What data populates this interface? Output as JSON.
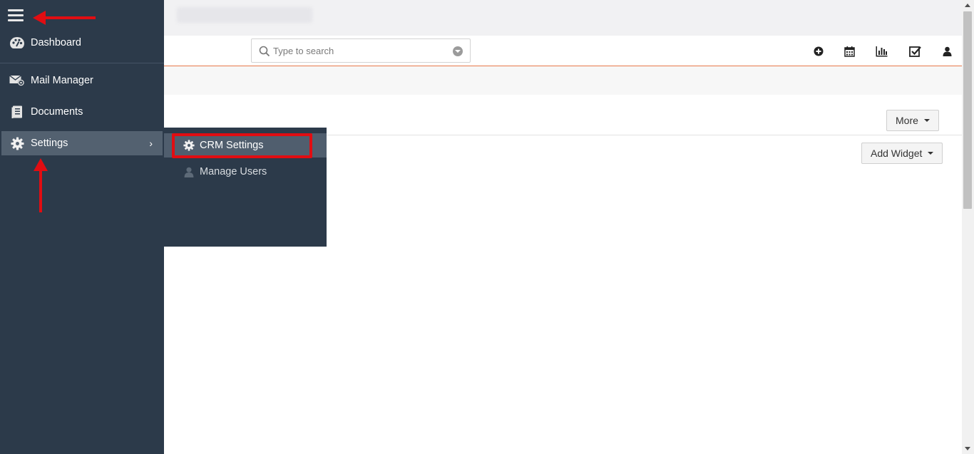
{
  "search": {
    "placeholder": "Type to search"
  },
  "header_icons": [
    "plus-circle-icon",
    "calendar-icon",
    "bar-chart-icon",
    "checkbox-icon",
    "user-icon"
  ],
  "sidebar": {
    "items": [
      {
        "label": "Dashboard",
        "icon": "palette-icon"
      },
      {
        "label": "Mail Manager",
        "icon": "mail-icon"
      },
      {
        "label": "Documents",
        "icon": "document-icon"
      },
      {
        "label": "Settings",
        "icon": "gear-icon"
      }
    ]
  },
  "submenu": {
    "items": [
      {
        "label": "CRM Settings",
        "icon": "gear-icon"
      },
      {
        "label": "Manage Users",
        "icon": "user-icon"
      }
    ]
  },
  "buttons": {
    "more": "More",
    "add_widget": "Add Widget"
  },
  "colors": {
    "sidebar": "#2c3a4a",
    "active_item": "#536170",
    "accent_line": "#e8784a",
    "annotation": "#e10d12"
  }
}
